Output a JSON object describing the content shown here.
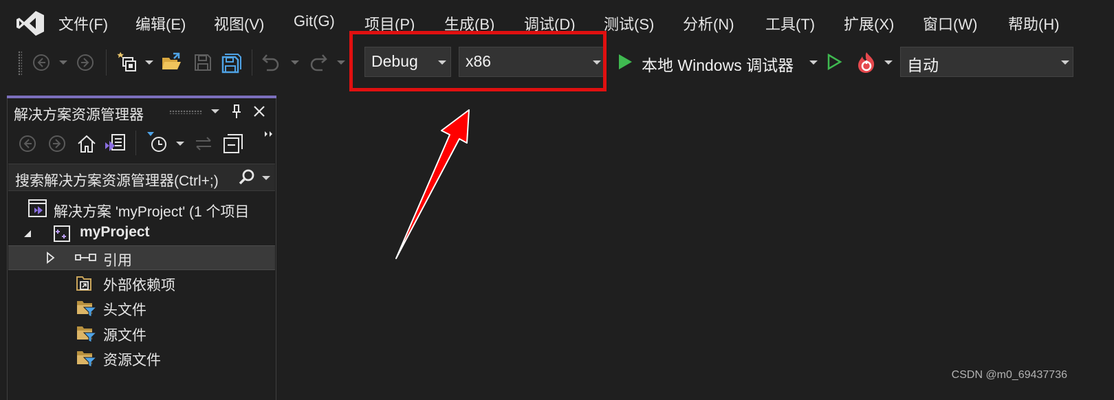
{
  "menu": {
    "items": [
      {
        "label": "文件(F)"
      },
      {
        "label": "编辑(E)"
      },
      {
        "label": "视图(V)"
      },
      {
        "label": "Git(G)"
      },
      {
        "label": "项目(P)"
      },
      {
        "label": "生成(B)"
      },
      {
        "label": "调试(D)"
      },
      {
        "label": "测试(S)"
      },
      {
        "label": "分析(N)"
      },
      {
        "label": "工具(T)"
      },
      {
        "label": "扩展(X)"
      },
      {
        "label": "窗口(W)"
      },
      {
        "label": "帮助(H)"
      }
    ]
  },
  "toolbar": {
    "configuration": "Debug",
    "platform": "x86",
    "run_target": "本地 Windows 调试器",
    "auto_combo": "自动",
    "icons": [
      "back-icon",
      "forward-icon",
      "new-project-icon",
      "open-folder-icon",
      "save-icon",
      "save-all-icon",
      "undo-icon",
      "redo-icon",
      "start-debug-icon",
      "start-no-debug-icon",
      "hot-reload-icon"
    ]
  },
  "solution_explorer": {
    "title": "解决方案资源管理器",
    "search_placeholder": "搜索解决方案资源管理器(Ctrl+;)",
    "tree": {
      "solution": "解决方案 'myProject' (1 个项目",
      "project": "myProject",
      "items": [
        {
          "label": "引用",
          "icon": "references-icon"
        },
        {
          "label": "外部依赖项",
          "icon": "external-deps-icon"
        },
        {
          "label": "头文件",
          "icon": "filter-folder-icon"
        },
        {
          "label": "源文件",
          "icon": "filter-folder-icon"
        },
        {
          "label": "资源文件",
          "icon": "filter-folder-icon"
        }
      ]
    }
  },
  "annotation": {
    "highlight_color": "#e01010"
  },
  "colors": {
    "accent": "#7b6fbc",
    "run_green": "#3fb950",
    "background": "#1f1f1f"
  },
  "watermark": "CSDN @m0_69437736"
}
